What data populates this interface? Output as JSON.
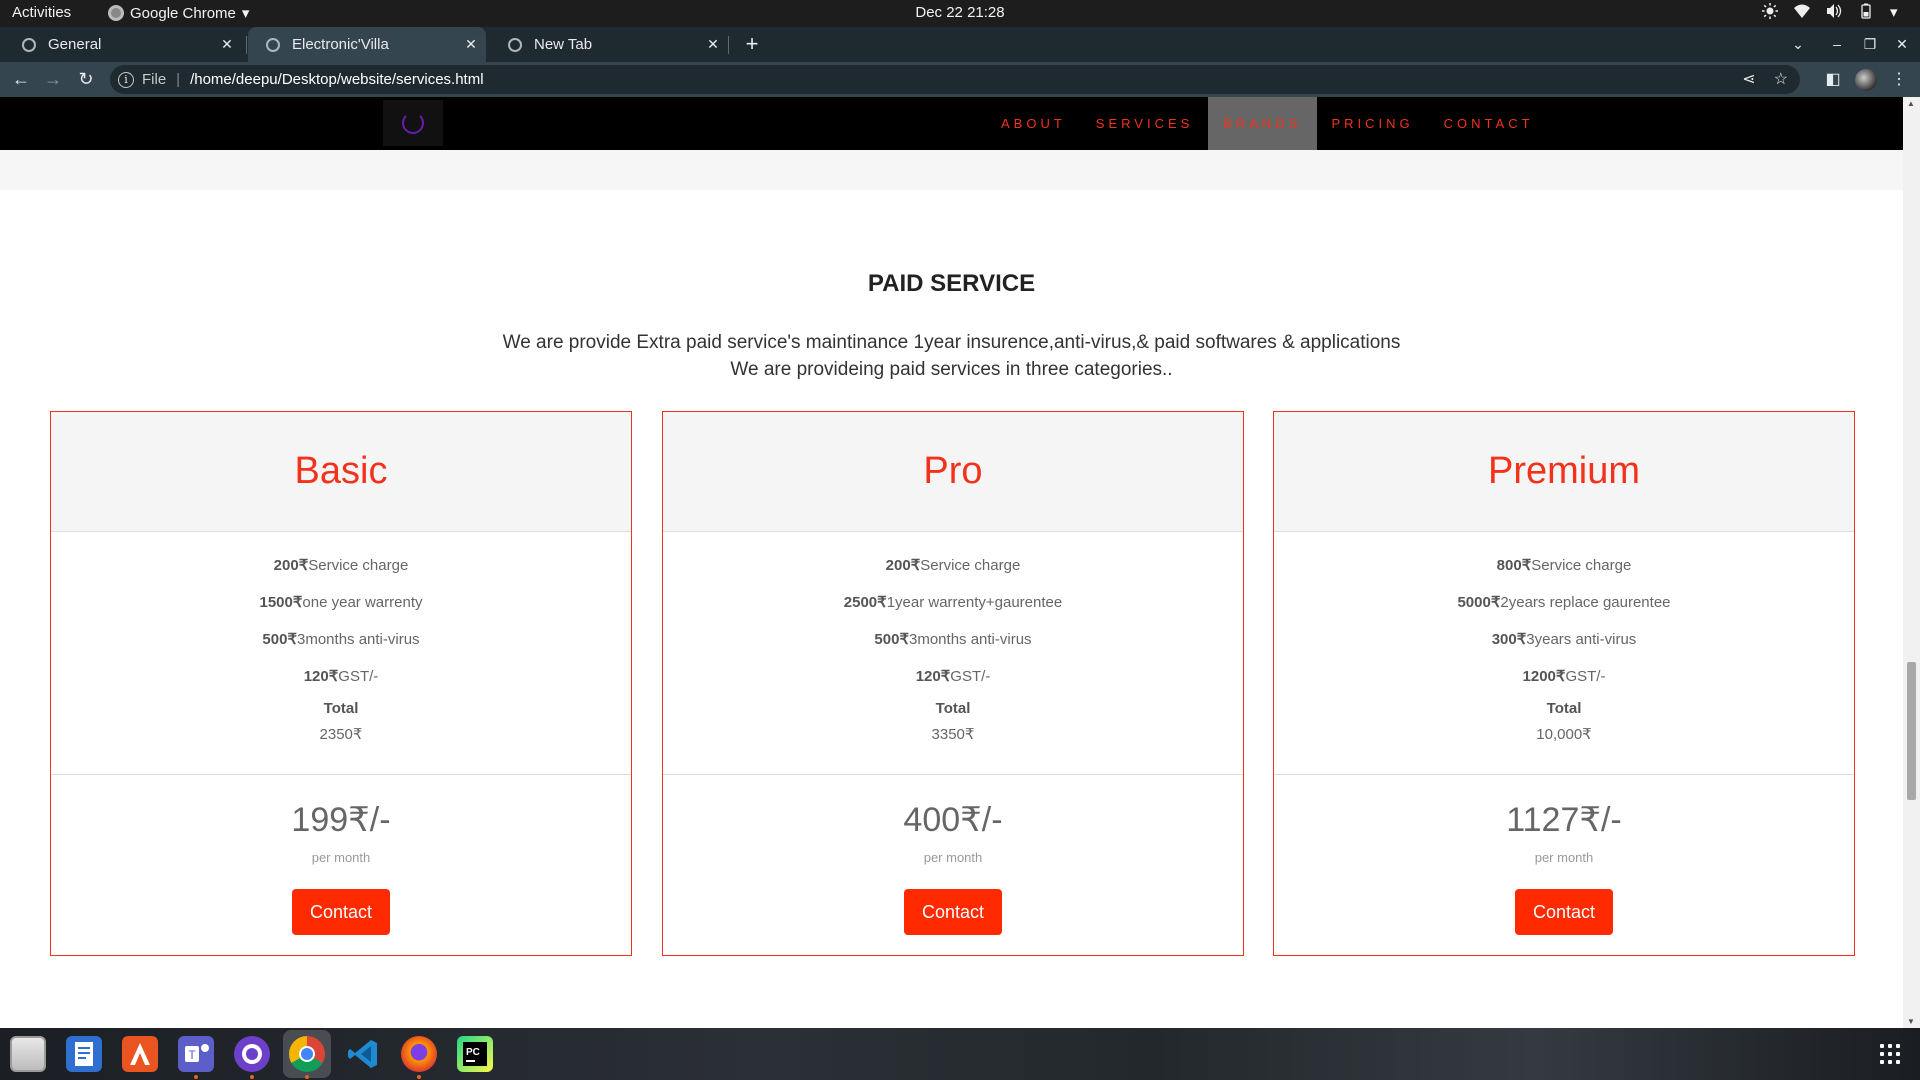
{
  "topbar": {
    "activities": "Activities",
    "app_name": "Google Chrome",
    "clock": "Dec 22  21:28"
  },
  "tabs": [
    {
      "label": "General",
      "active": false
    },
    {
      "label": "Electronic'Villa",
      "active": true
    },
    {
      "label": "New Tab",
      "active": false
    }
  ],
  "omnibox": {
    "scheme": "File",
    "url": "/home/deepu/Desktop/website/services.html"
  },
  "site": {
    "nav": [
      "ABOUT",
      "SERVICES",
      "BRANDS",
      "PRICING",
      "CONTACT"
    ],
    "nav_active": "BRANDS",
    "section_title": "PAID SERVICE",
    "section_line1": "We are provide Extra paid service's maintinance 1year insurence,anti-virus,& paid softwares & applications",
    "section_line2": "We are provideing paid services in three categories..",
    "accent_color": "#f4321c"
  },
  "plans": [
    {
      "name": "Basic",
      "features": [
        {
          "amount": "200₹",
          "text": "Service charge"
        },
        {
          "amount": "1500₹",
          "text": "one year warrenty"
        },
        {
          "amount": "500₹",
          "text": "3months anti-virus"
        },
        {
          "amount": "120₹",
          "text": "GST/-"
        }
      ],
      "total_label": "Total",
      "total": "2350₹",
      "price": "199₹/-",
      "period": "per month",
      "button": "Contact"
    },
    {
      "name": "Pro",
      "features": [
        {
          "amount": "200₹",
          "text": "Service charge"
        },
        {
          "amount": "2500₹",
          "text": "1year warrenty+gaurentee"
        },
        {
          "amount": "500₹",
          "text": "3months anti-virus"
        },
        {
          "amount": "120₹",
          "text": "GST/-"
        }
      ],
      "total_label": "Total",
      "total": "3350₹",
      "price": "400₹/-",
      "period": "per month",
      "button": "Contact"
    },
    {
      "name": "Premium",
      "features": [
        {
          "amount": "800₹",
          "text": "Service charge"
        },
        {
          "amount": "5000₹",
          "text": "2years replace gaurentee"
        },
        {
          "amount": "300₹",
          "text": "3years anti-virus"
        },
        {
          "amount": "1200₹",
          "text": "GST/-"
        }
      ],
      "total_label": "Total",
      "total": "10,000₹",
      "price": "1127₹/-",
      "period": "per month",
      "button": "Contact"
    }
  ],
  "dock": [
    "files-icon",
    "text-editor-icon",
    "software-center-icon",
    "teams-icon",
    "github-desktop-icon",
    "chrome-icon",
    "vscode-icon",
    "firefox-icon",
    "pycharm-icon"
  ]
}
